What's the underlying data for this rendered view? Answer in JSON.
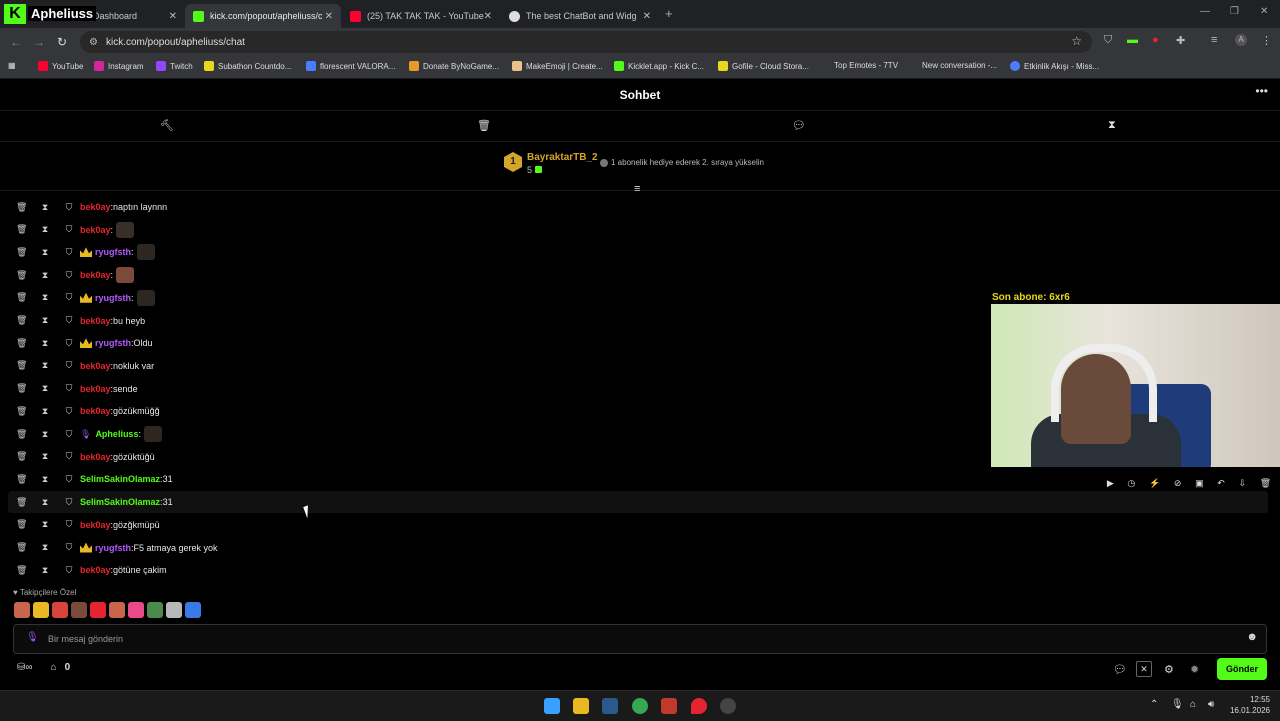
{
  "browser": {
    "tabs": [
      {
        "title": "Dashboard",
        "color": "#53fc18"
      },
      {
        "title": "kick.com/popout/apheliuss/cha",
        "color": "#53fc18"
      },
      {
        "title": "(25) TAK TAK TAK - YouTube",
        "color": "#ff0033"
      },
      {
        "title": "The best ChatBot and Widgets",
        "color": "#dddddd"
      }
    ],
    "url": "kick.com/popout/apheliuss/chat",
    "bookmarks": [
      {
        "label": "YouTube",
        "color": "#ff0033"
      },
      {
        "label": "Instagram",
        "color": "#d6249f"
      },
      {
        "label": "Twitch",
        "color": "#9146ff"
      },
      {
        "label": "Subathon Countdo...",
        "color": "#e8d71a"
      },
      {
        "label": "florescent VALORA...",
        "color": "#4a7cff"
      },
      {
        "label": "Donate ByNoGame...",
        "color": "#e89a2a"
      },
      {
        "label": "MakeEmoji | Create...",
        "color": "#e8c28a"
      },
      {
        "label": "Kicklet.app - Kick C...",
        "color": "#53fc18"
      },
      {
        "label": "Gofile - Cloud Stora...",
        "color": "#e8d71a"
      },
      {
        "label": "Top Emotes - 7TV",
        "color": "#35363a"
      },
      {
        "label": "New conversation -...",
        "color": "#35363a"
      },
      {
        "label": "Etkinlik Akışı - Miss...",
        "color": "#4a7cff"
      }
    ]
  },
  "overlay": {
    "brand_letter": "K",
    "brand_name": "Apheliuss",
    "last_sub": "Son abone: 6xr6"
  },
  "chat": {
    "title": "Sohbet",
    "leader": {
      "rank": "1",
      "name": "BayraktarTB_2",
      "count": "5",
      "hint": "1 abonelik hediye ederek 2. sıraya yükselin"
    },
    "messages": [
      {
        "user": "bek0ay",
        "color": "#e5242f",
        "text": "naptın laynnn",
        "crown": false,
        "emote": false
      },
      {
        "user": "bek0ay",
        "color": "#e5242f",
        "text": "",
        "crown": false,
        "emote": true
      },
      {
        "user": "ryugfsth",
        "color": "#b25aff",
        "text": "",
        "crown": true,
        "emote": true
      },
      {
        "user": "bek0ay",
        "color": "#e5242f",
        "text": "",
        "crown": false,
        "emote": true
      },
      {
        "user": "ryugfsth",
        "color": "#b25aff",
        "text": "",
        "crown": true,
        "emote": true
      },
      {
        "user": "bek0ay",
        "color": "#e5242f",
        "text": "bu heyb",
        "crown": false,
        "emote": false
      },
      {
        "user": "ryugfsth",
        "color": "#b25aff",
        "text": "Oldu",
        "crown": true,
        "emote": false
      },
      {
        "user": "bek0ay",
        "color": "#e5242f",
        "text": "nokluk var",
        "crown": false,
        "emote": false
      },
      {
        "user": "bek0ay",
        "color": "#e5242f",
        "text": "sende",
        "crown": false,
        "emote": false
      },
      {
        "user": "bek0ay",
        "color": "#e5242f",
        "text": "gözükmüğğ",
        "crown": false,
        "emote": false
      },
      {
        "user": "Apheliuss",
        "color": "#53fc18",
        "text": "",
        "crown": false,
        "emote": true,
        "mic": true
      },
      {
        "user": "bek0ay",
        "color": "#e5242f",
        "text": "gözüktüğü",
        "crown": false,
        "emote": false
      },
      {
        "user": "SelimSakinOlamaz",
        "color": "#53fc18",
        "text": "31",
        "crown": false,
        "emote": false
      },
      {
        "user": "SelimSakinOlamaz",
        "color": "#53fc18",
        "text": "31",
        "crown": false,
        "emote": false,
        "highlight": true
      },
      {
        "user": "bek0ay",
        "color": "#e5242f",
        "text": "gözğkmüpü",
        "crown": false,
        "emote": false
      },
      {
        "user": "ryugfsth",
        "color": "#b25aff",
        "text": "F5 atmaya gerek yok",
        "crown": true,
        "emote": false
      },
      {
        "user": "bek0ay",
        "color": "#e5242f",
        "text": "götüne çakim",
        "crown": false,
        "emote": false
      }
    ],
    "followers_only": "Takipçilere Özel",
    "input_placeholder": "Bir mesaj gönderin",
    "points": "0",
    "send_label": "Gönder"
  },
  "taskbar": {
    "time": "12:55",
    "date": "16.01.2026"
  }
}
